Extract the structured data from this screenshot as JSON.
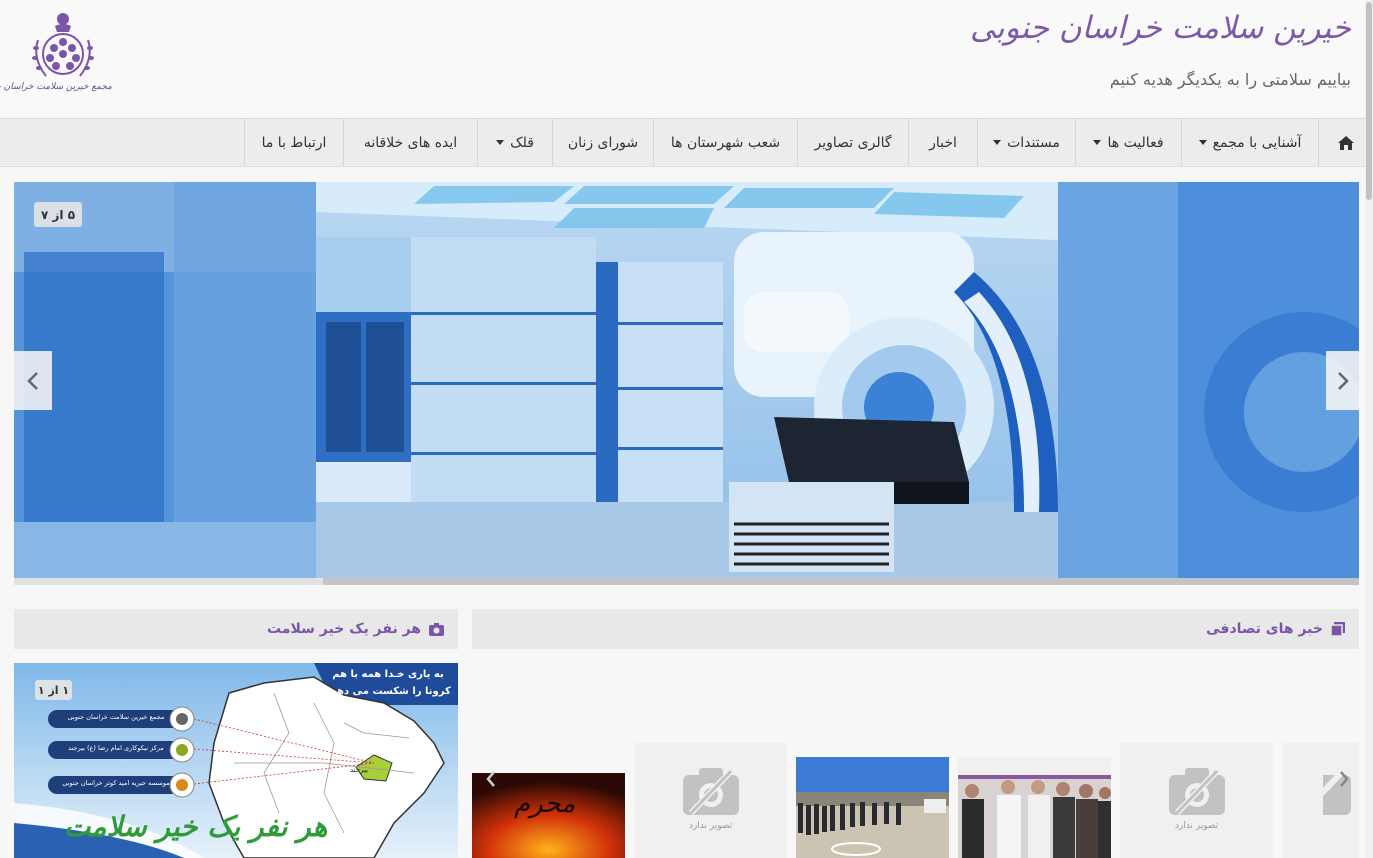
{
  "header": {
    "title": "خیرین سلامت خراسان جنوبی",
    "slogan": "بیاییم سلامتی را به یکدیگر هدیه کنیم",
    "logo_caption": "مجمع خیرین سلامت خراسان جنوبی"
  },
  "nav": {
    "home_icon": "home-icon",
    "items": [
      {
        "label": "آشنایی با مجمع",
        "dropdown": true
      },
      {
        "label": "فعالیت ها",
        "dropdown": true
      },
      {
        "label": "مستندات",
        "dropdown": true
      },
      {
        "label": "اخبار",
        "dropdown": false
      },
      {
        "label": "گالری تصاویر",
        "dropdown": false
      },
      {
        "label": "شعب شهرستان ها",
        "dropdown": false
      },
      {
        "label": "شورای زنان",
        "dropdown": false
      },
      {
        "label": "قلک",
        "dropdown": true
      },
      {
        "label": "ایده های خلاقانه",
        "dropdown": false
      },
      {
        "label": "ارتباط با ما",
        "dropdown": false
      }
    ]
  },
  "slider": {
    "counter": "۵ از ۷",
    "progress": 0.77
  },
  "random_news": {
    "title": "خبر های تصادفی",
    "icon": "news-icon",
    "no_image_text": "تصویر ندارد",
    "thumb_mhr_text": "محرم"
  },
  "health_panel": {
    "title": "هر نفر یک خیر سلامت",
    "icon": "camera-icon",
    "counter": "۱ از ۱",
    "poster_line1": "به یاری خـدا همه با هم",
    "poster_line2": "کرونا را شکست می دهیم",
    "poster_item1": "مجمع خیرین سلامت خراسان جنوبی",
    "poster_item2": "مرکز نیکوکاری امام رضا (ع) بیرجند",
    "poster_item3": "موسسه خیریه امید کوثر خراسان جنوبی",
    "poster_city": "بیرجند",
    "poster_big": "هر نفر یک خیر سلامت"
  },
  "colors": {
    "brand_purple": "#7a55a8",
    "nav_bg": "#ececec",
    "panel_bg": "#e8e8e8"
  }
}
